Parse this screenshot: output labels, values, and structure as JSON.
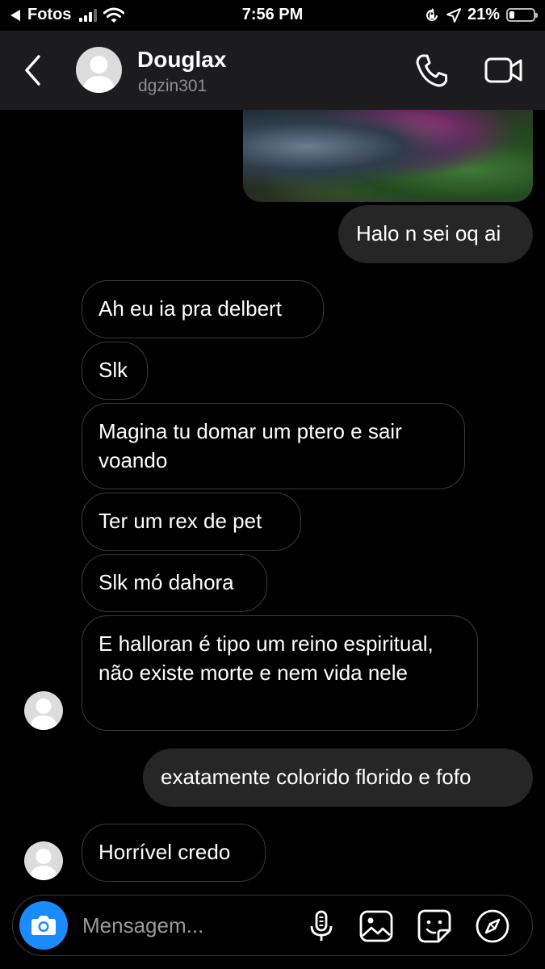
{
  "status_bar": {
    "back_app": "Fotos",
    "time": "7:56 PM",
    "battery_percent": "21%",
    "battery_level": 0.21
  },
  "header": {
    "name": "Douglax",
    "username": "dgzin301"
  },
  "messages": [
    {
      "from": "me",
      "text": "Halo n sei oq ai"
    },
    {
      "from": "them",
      "text": "Ah eu ia pra delbert"
    },
    {
      "from": "them",
      "text": "Slk"
    },
    {
      "from": "them",
      "text": "Magina tu domar um ptero e sair voando"
    },
    {
      "from": "them",
      "text": "Ter um rex de pet"
    },
    {
      "from": "them",
      "text": "Slk mó dahora"
    },
    {
      "from": "them",
      "text": "E halloran é tipo um reino espiritual, não existe morte e nem vida nele"
    },
    {
      "from": "me",
      "text": "exatamente colorido florido e fofo"
    },
    {
      "from": "them",
      "text": "Horrível credo"
    }
  ],
  "composer": {
    "placeholder": "Mensagem..."
  },
  "colors": {
    "accent": "#1a8cff",
    "header_bg": "#1c1c1e",
    "outgoing_bubble": "#262626",
    "incoming_border": "#3a3a3c"
  },
  "icons": [
    "back-chevron-icon",
    "phone-icon",
    "video-camera-icon",
    "camera-icon",
    "microphone-icon",
    "gallery-icon",
    "sticker-icon",
    "compass-icon"
  ]
}
